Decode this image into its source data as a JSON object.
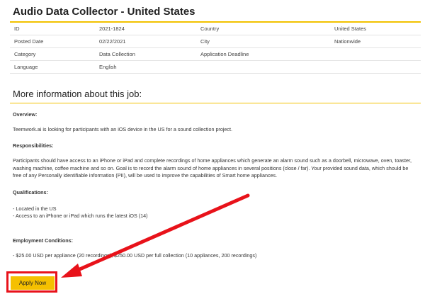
{
  "job": {
    "title": "Audio Data Collector - United States",
    "details": [
      {
        "label_left": "ID",
        "value_left": "2021-1824",
        "label_right": "Country",
        "value_right": "United States"
      },
      {
        "label_left": "Posted Date",
        "value_left": "02/22/2021",
        "label_right": "City",
        "value_right": "Nationwide"
      },
      {
        "label_left": "Category",
        "value_left": "Data Collection",
        "label_right": "Application Deadline",
        "value_right": ""
      },
      {
        "label_left": "Language",
        "value_left": "English",
        "label_right": "",
        "value_right": ""
      }
    ]
  },
  "more_info": {
    "heading": "More information about this job:",
    "overview_label": "Overview:",
    "overview_text": "Teemwork.ai is looking for participants with an iOS device in the US for a sound collection project.",
    "responsibilities_label": "Responsibilities:",
    "responsibilities_text": "Participants should have access to an iPhone or iPad and complete recordings of home appliances which generate an alarm sound such as a doorbell, microwave, oven, toaster, washing machine, coffee machine and so on. Goal is to record the alarm sound of home appliances in several positions (close / far). Your provided sound data, which should be free of any Personally identifiable information (PII), will be used to improve the capabilities of Smart home appliances.",
    "qualifications_label": "Qualifications:",
    "qualifications_items": [
      "- Located in the US",
      "- Access to an iPhone or iPad which runs the latest iOS (14)"
    ],
    "employment_label": "Employment Conditions:",
    "employment_text": "- $25.00 USD per appliance (20 recordings), $250.00 USD per full collection (10 appliances, 200 recordings)"
  },
  "apply_button": {
    "label": "Apply Now"
  },
  "colors": {
    "accent": "#f2c200",
    "button": "#f5c000",
    "annotation": "#e8121a"
  }
}
